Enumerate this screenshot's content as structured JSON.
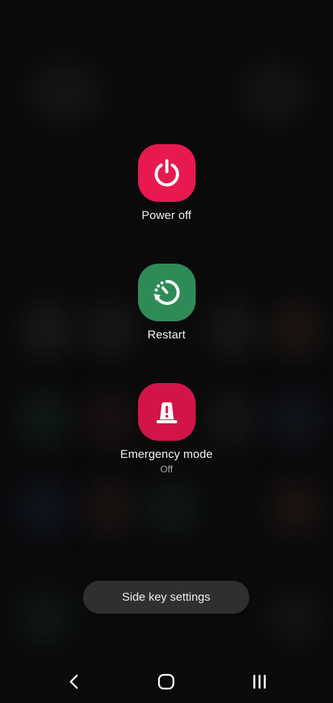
{
  "actions": {
    "power_off": {
      "label": "Power off",
      "color": "#e8194f",
      "icon": "power-icon"
    },
    "restart": {
      "label": "Restart",
      "color": "#2e8b57",
      "icon": "restart-icon"
    },
    "emergency": {
      "label": "Emergency mode",
      "status": "Off",
      "color": "#d31448",
      "icon": "emergency-siren-icon"
    }
  },
  "side_key_settings": {
    "label": "Side key settings"
  },
  "navbar": {
    "back_icon": "back-chevron-icon",
    "home_icon": "home-icon",
    "recents_icon": "recents-icon"
  }
}
